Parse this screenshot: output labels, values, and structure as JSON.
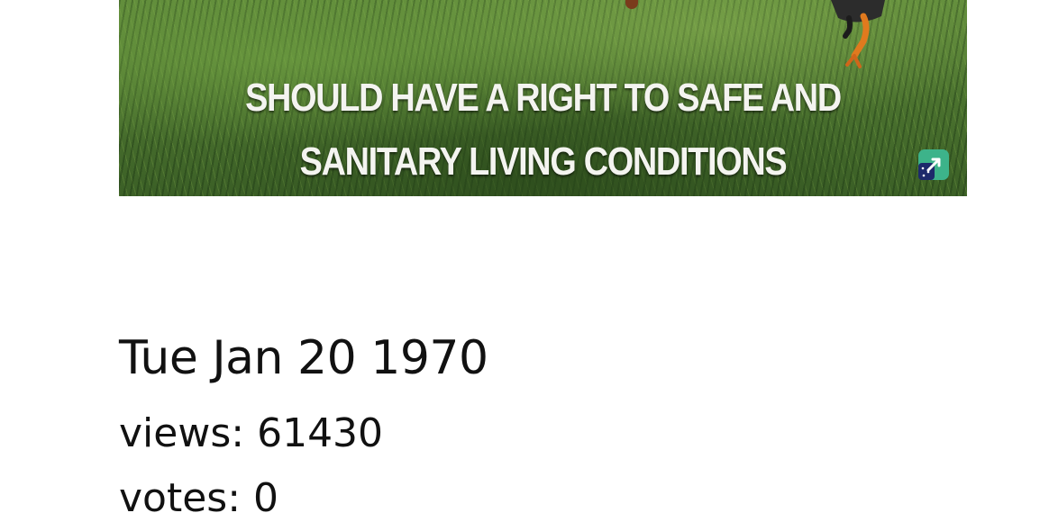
{
  "video": {
    "caption_line_1": "SHOULD HAVE A RIGHT TO SAFE AND",
    "caption_line_2": "SANITARY LIVING CONDITIONS",
    "badge_icon": "channel-logo-icon"
  },
  "meta": {
    "date": "Tue Jan 20 1970",
    "views_label": "views:",
    "views_value": "61430",
    "votes_label": "votes:",
    "votes_value": "0"
  },
  "colors": {
    "text": "#111111",
    "background": "#ffffff",
    "caption": "#f4f4f0",
    "grass": "#4d7530"
  }
}
